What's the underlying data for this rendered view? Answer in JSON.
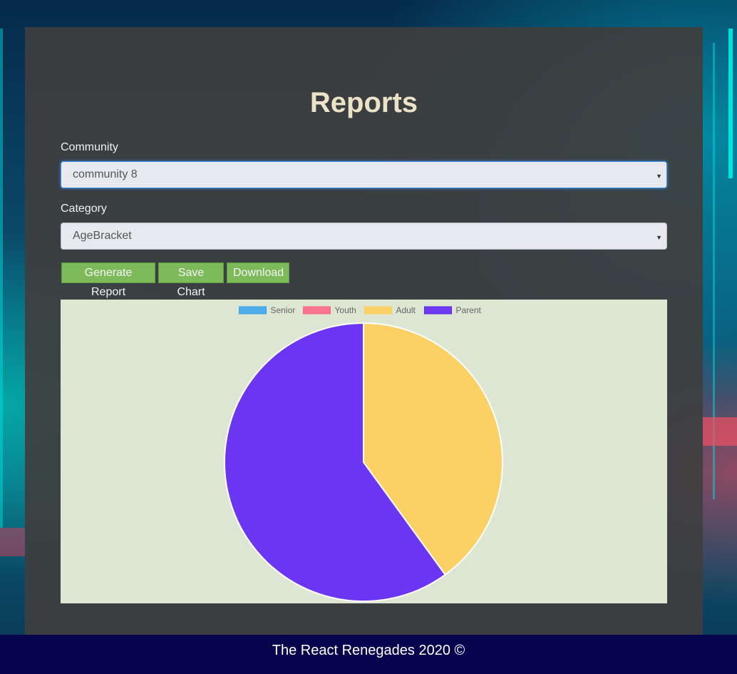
{
  "page": {
    "title": "Reports"
  },
  "form": {
    "community": {
      "label": "Community",
      "value": "community 8"
    },
    "category": {
      "label": "Category",
      "value": "AgeBracket"
    }
  },
  "buttons": {
    "generate": "Generate Report",
    "save_chart": "Save Chart",
    "download": "Download"
  },
  "footer": {
    "text": "The React Renegades 2020 ©"
  },
  "colors": {
    "Senior": "#36a2eb",
    "Youth": "#ff6384",
    "Adult": "#ffce56",
    "Parent": "#5b1cf5"
  },
  "chart_data": {
    "type": "pie",
    "categories": [
      "Senior",
      "Youth",
      "Adult",
      "Parent"
    ],
    "values": [
      0,
      0,
      4,
      6
    ],
    "legend_position": "top"
  }
}
